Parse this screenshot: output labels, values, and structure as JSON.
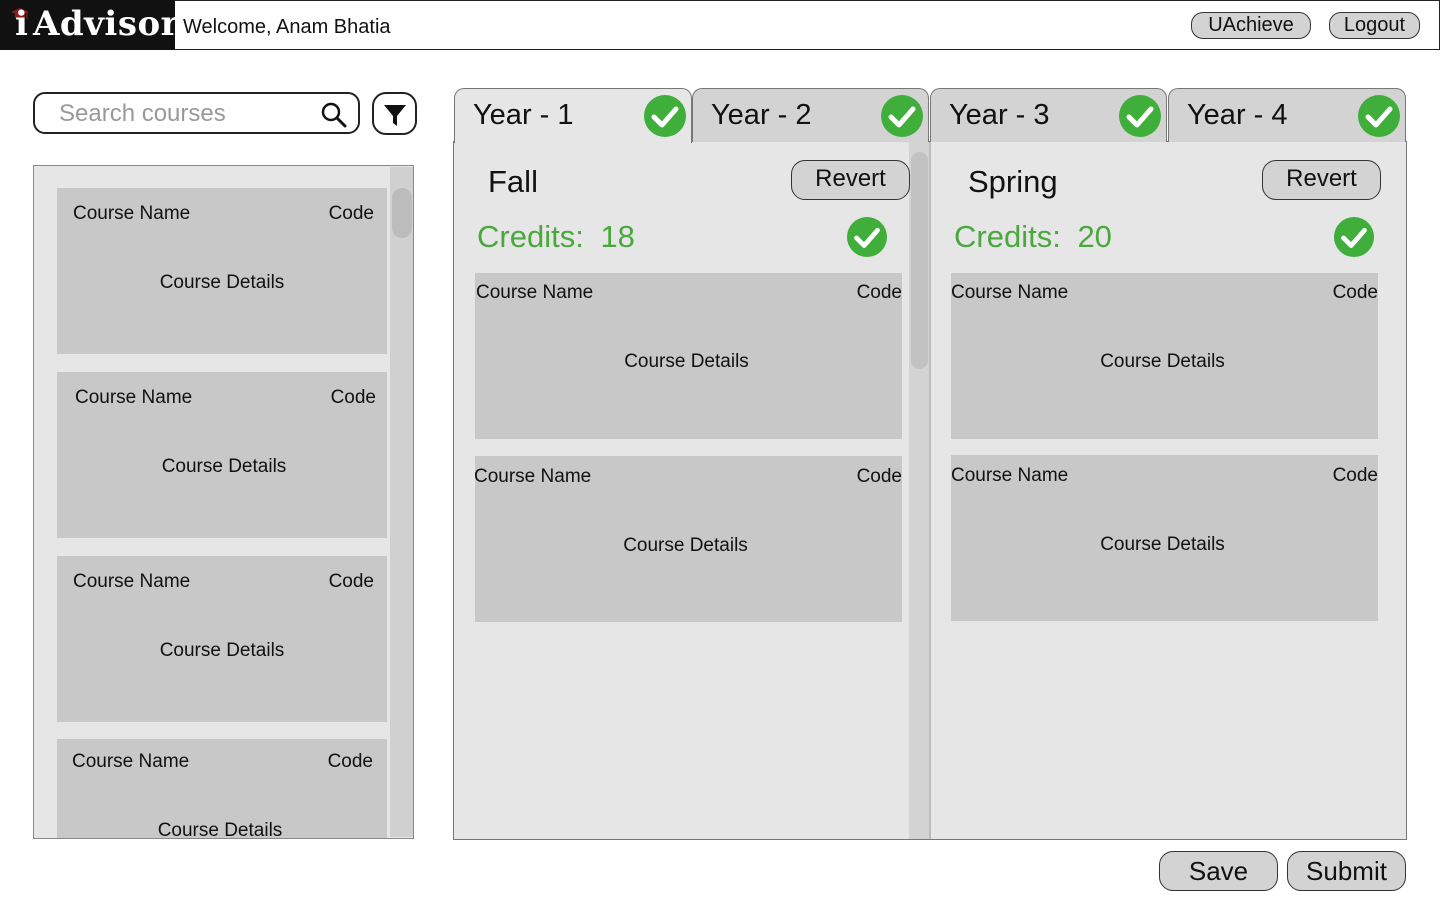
{
  "header": {
    "logo_text": "Advisor",
    "logo_letter": "i",
    "welcome": "Welcome, Anam Bhatia",
    "uachieve_label": "UAchieve",
    "logout_label": "Logout"
  },
  "search": {
    "placeholder": "Search courses",
    "icon": "search-icon",
    "filter_icon": "filter-icon"
  },
  "course_list": {
    "items": [
      {
        "name": "Course Name",
        "code": "Code",
        "details": "Course Details"
      },
      {
        "name": "Course Name",
        "code": "Code",
        "details": "Course Details"
      },
      {
        "name": "Course Name",
        "code": "Code",
        "details": "Course Details"
      },
      {
        "name": "Course Name",
        "code": "Code",
        "details": "Course Details"
      }
    ]
  },
  "tabs": [
    {
      "label": "Year - 1",
      "complete": true,
      "active": true
    },
    {
      "label": "Year - 2",
      "complete": true,
      "active": false
    },
    {
      "label": "Year - 3",
      "complete": true,
      "active": false
    },
    {
      "label": "Year - 4",
      "complete": true,
      "active": false
    }
  ],
  "semesters": {
    "fall": {
      "title": "Fall",
      "revert_label": "Revert",
      "credits_label": "Credits:",
      "credits_value": "18",
      "courses": [
        {
          "name": "Course Name",
          "code": "Code",
          "details": "Course Details"
        },
        {
          "name": "Course Name",
          "code": "Code",
          "details": "Course Details"
        }
      ]
    },
    "spring": {
      "title": "Spring",
      "revert_label": "Revert",
      "credits_label": "Credits:",
      "credits_value": "20",
      "courses": [
        {
          "name": "Course Name",
          "code": "Code",
          "details": "Course Details"
        },
        {
          "name": "Course Name",
          "code": "Code",
          "details": "Course Details"
        }
      ]
    }
  },
  "actions": {
    "save_label": "Save",
    "submit_label": "Submit"
  },
  "colors": {
    "check_green": "#3fae3a",
    "credits_green": "#4aa83e",
    "card_gray": "#c8c8c8",
    "panel_gray": "#e6e6e6"
  }
}
